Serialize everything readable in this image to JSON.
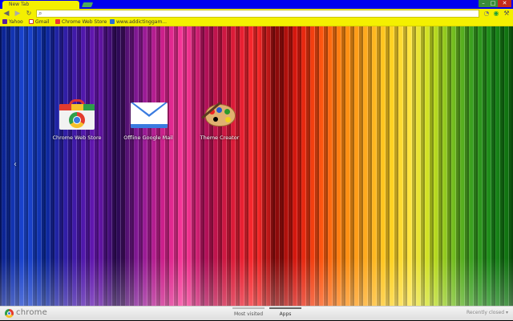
{
  "window": {
    "tab_title": "New Tab",
    "controls": {
      "minimize": "–",
      "maximize": "□",
      "close": "✕"
    }
  },
  "toolbar": {
    "back_icon": "◀",
    "forward_icon": "▶",
    "reload_icon": "↻",
    "search_icon": "🔍",
    "omnibox_value": "",
    "extensions": [
      "extension-icon",
      "eye-extension-icon"
    ],
    "menu_icon": "wrench-icon"
  },
  "bookmarks": [
    {
      "label": "Yahoo",
      "icon": "yahoo-favicon"
    },
    {
      "label": "Gmail",
      "icon": "gmail-favicon"
    },
    {
      "label": "Chrome Web Store",
      "icon": "chrome-web-store-favicon"
    },
    {
      "label": "www.addictinggam...",
      "icon": "addictinggames-favicon"
    }
  ],
  "apps": [
    {
      "label": "Chrome Web Store",
      "icon": "chrome-web-store-icon"
    },
    {
      "label": "Offline Google Mail",
      "icon": "gmail-envelope-icon"
    },
    {
      "label": "Theme Creator",
      "icon": "paint-palette-icon"
    }
  ],
  "ntp": {
    "prev_arrow": "‹",
    "background": "rainbow-vertical-stripes"
  },
  "footer": {
    "brand": "chrome",
    "tabs": [
      {
        "label": "Most visited",
        "selected": false
      },
      {
        "label": "Apps",
        "selected": true
      }
    ],
    "recently_closed": "Recently closed ▾"
  },
  "colors": {
    "frame": "#0000ee",
    "toolbar": "#f4f000",
    "close_button": "#c42b1c"
  }
}
